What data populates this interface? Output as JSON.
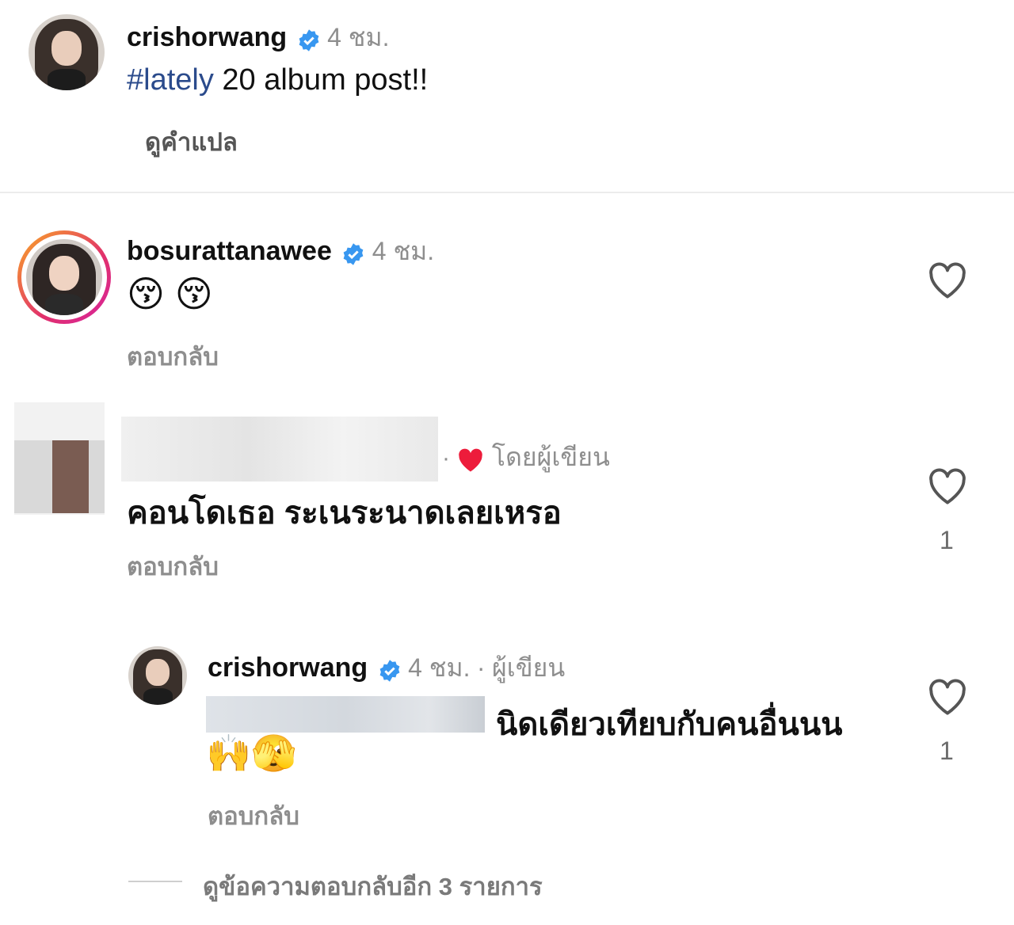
{
  "caption": {
    "username": "crishorwang",
    "time": "4 ชม.",
    "hashtag": "#lately",
    "text": " 20 album post!!",
    "translate_label": "ดูคำแปล"
  },
  "comments": [
    {
      "username": "bosurattanawee",
      "time": "4 ชม.",
      "emojis": "😚 😚",
      "reply_label": "ตอบกลับ"
    },
    {
      "author_like_label": "โดยผู้เขียน",
      "separator": "·",
      "text": "คอนโดเธอ ระเนระนาดเลยเหรอ",
      "reply_label": "ตอบกลับ",
      "like_count": "1"
    }
  ],
  "reply": {
    "username": "crishorwang",
    "time": "4 ชม.",
    "separator": "·",
    "author_label": "ผู้เขียน",
    "text": "นิดเดียวเทียบกับคนอื่นนน",
    "emojis": "🙌🫣",
    "reply_label": "ตอบกลับ",
    "like_count": "1"
  },
  "view_more_replies": "ดูข้อความตอบกลับอีก 3 รายการ",
  "colors": {
    "verified": "#3897f0",
    "hashtag": "#2b4b8c",
    "muted": "#8e8e8e",
    "author_heart": "#ed1c3b",
    "story_ring_start": "#f9a825",
    "story_ring_end": "#d6249f"
  }
}
